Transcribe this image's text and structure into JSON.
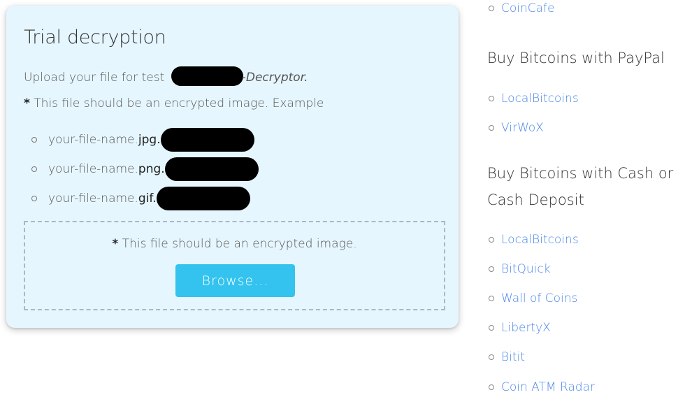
{
  "card": {
    "title": "Trial decryption",
    "intro_prefix": "Upload your file for test ",
    "intro_suffix": "-Decryptor.",
    "note_star": "*",
    "note_text": " This file should be an encrypted image. Example",
    "examples": [
      {
        "base": "your-file-name.",
        "ext": "jpg."
      },
      {
        "base": "your-file-name.",
        "ext": "png."
      },
      {
        "base": "your-file-name.",
        "ext": "gif."
      }
    ],
    "dropzone": {
      "note_star": "*",
      "note_text": " This file should be an encrypted image.",
      "browse_label": "Browse..."
    }
  },
  "sidebar": {
    "top_link": "CoinCafe",
    "sections": [
      {
        "heading": "Buy Bitcoins with PayPal",
        "links": [
          "LocalBitcoins",
          "VirWoX"
        ]
      },
      {
        "heading": "Buy Bitcoins with Cash or Cash Deposit",
        "links": [
          "LocalBitcoins",
          "BitQuick",
          "Wall of Coins",
          "LibertyX",
          "Bitit",
          "Coin ATM Radar"
        ]
      }
    ]
  },
  "colors": {
    "card_bg": "#e6f6fe",
    "button": "#33c3ee",
    "link": "#4a86e8",
    "redaction": "#000000"
  }
}
